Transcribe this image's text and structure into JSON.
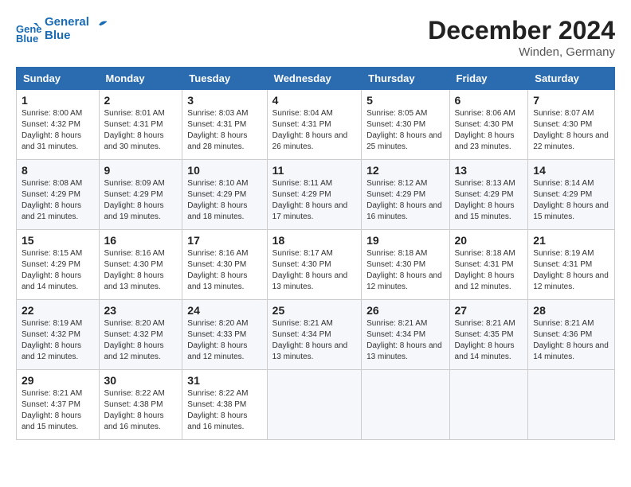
{
  "header": {
    "logo_line1": "General",
    "logo_line2": "Blue",
    "month_title": "December 2024",
    "location": "Winden, Germany"
  },
  "weekdays": [
    "Sunday",
    "Monday",
    "Tuesday",
    "Wednesday",
    "Thursday",
    "Friday",
    "Saturday"
  ],
  "weeks": [
    [
      {
        "day": "1",
        "sunrise": "8:00 AM",
        "sunset": "4:32 PM",
        "daylight": "8 hours and 31 minutes."
      },
      {
        "day": "2",
        "sunrise": "8:01 AM",
        "sunset": "4:31 PM",
        "daylight": "8 hours and 30 minutes."
      },
      {
        "day": "3",
        "sunrise": "8:03 AM",
        "sunset": "4:31 PM",
        "daylight": "8 hours and 28 minutes."
      },
      {
        "day": "4",
        "sunrise": "8:04 AM",
        "sunset": "4:31 PM",
        "daylight": "8 hours and 26 minutes."
      },
      {
        "day": "5",
        "sunrise": "8:05 AM",
        "sunset": "4:30 PM",
        "daylight": "8 hours and 25 minutes."
      },
      {
        "day": "6",
        "sunrise": "8:06 AM",
        "sunset": "4:30 PM",
        "daylight": "8 hours and 23 minutes."
      },
      {
        "day": "7",
        "sunrise": "8:07 AM",
        "sunset": "4:30 PM",
        "daylight": "8 hours and 22 minutes."
      }
    ],
    [
      {
        "day": "8",
        "sunrise": "8:08 AM",
        "sunset": "4:29 PM",
        "daylight": "8 hours and 21 minutes."
      },
      {
        "day": "9",
        "sunrise": "8:09 AM",
        "sunset": "4:29 PM",
        "daylight": "8 hours and 19 minutes."
      },
      {
        "day": "10",
        "sunrise": "8:10 AM",
        "sunset": "4:29 PM",
        "daylight": "8 hours and 18 minutes."
      },
      {
        "day": "11",
        "sunrise": "8:11 AM",
        "sunset": "4:29 PM",
        "daylight": "8 hours and 17 minutes."
      },
      {
        "day": "12",
        "sunrise": "8:12 AM",
        "sunset": "4:29 PM",
        "daylight": "8 hours and 16 minutes."
      },
      {
        "day": "13",
        "sunrise": "8:13 AM",
        "sunset": "4:29 PM",
        "daylight": "8 hours and 15 minutes."
      },
      {
        "day": "14",
        "sunrise": "8:14 AM",
        "sunset": "4:29 PM",
        "daylight": "8 hours and 15 minutes."
      }
    ],
    [
      {
        "day": "15",
        "sunrise": "8:15 AM",
        "sunset": "4:29 PM",
        "daylight": "8 hours and 14 minutes."
      },
      {
        "day": "16",
        "sunrise": "8:16 AM",
        "sunset": "4:30 PM",
        "daylight": "8 hours and 13 minutes."
      },
      {
        "day": "17",
        "sunrise": "8:16 AM",
        "sunset": "4:30 PM",
        "daylight": "8 hours and 13 minutes."
      },
      {
        "day": "18",
        "sunrise": "8:17 AM",
        "sunset": "4:30 PM",
        "daylight": "8 hours and 13 minutes."
      },
      {
        "day": "19",
        "sunrise": "8:18 AM",
        "sunset": "4:30 PM",
        "daylight": "8 hours and 12 minutes."
      },
      {
        "day": "20",
        "sunrise": "8:18 AM",
        "sunset": "4:31 PM",
        "daylight": "8 hours and 12 minutes."
      },
      {
        "day": "21",
        "sunrise": "8:19 AM",
        "sunset": "4:31 PM",
        "daylight": "8 hours and 12 minutes."
      }
    ],
    [
      {
        "day": "22",
        "sunrise": "8:19 AM",
        "sunset": "4:32 PM",
        "daylight": "8 hours and 12 minutes."
      },
      {
        "day": "23",
        "sunrise": "8:20 AM",
        "sunset": "4:32 PM",
        "daylight": "8 hours and 12 minutes."
      },
      {
        "day": "24",
        "sunrise": "8:20 AM",
        "sunset": "4:33 PM",
        "daylight": "8 hours and 12 minutes."
      },
      {
        "day": "25",
        "sunrise": "8:21 AM",
        "sunset": "4:34 PM",
        "daylight": "8 hours and 13 minutes."
      },
      {
        "day": "26",
        "sunrise": "8:21 AM",
        "sunset": "4:34 PM",
        "daylight": "8 hours and 13 minutes."
      },
      {
        "day": "27",
        "sunrise": "8:21 AM",
        "sunset": "4:35 PM",
        "daylight": "8 hours and 14 minutes."
      },
      {
        "day": "28",
        "sunrise": "8:21 AM",
        "sunset": "4:36 PM",
        "daylight": "8 hours and 14 minutes."
      }
    ],
    [
      {
        "day": "29",
        "sunrise": "8:21 AM",
        "sunset": "4:37 PM",
        "daylight": "8 hours and 15 minutes."
      },
      {
        "day": "30",
        "sunrise": "8:22 AM",
        "sunset": "4:38 PM",
        "daylight": "8 hours and 16 minutes."
      },
      {
        "day": "31",
        "sunrise": "8:22 AM",
        "sunset": "4:38 PM",
        "daylight": "8 hours and 16 minutes."
      },
      null,
      null,
      null,
      null
    ]
  ]
}
